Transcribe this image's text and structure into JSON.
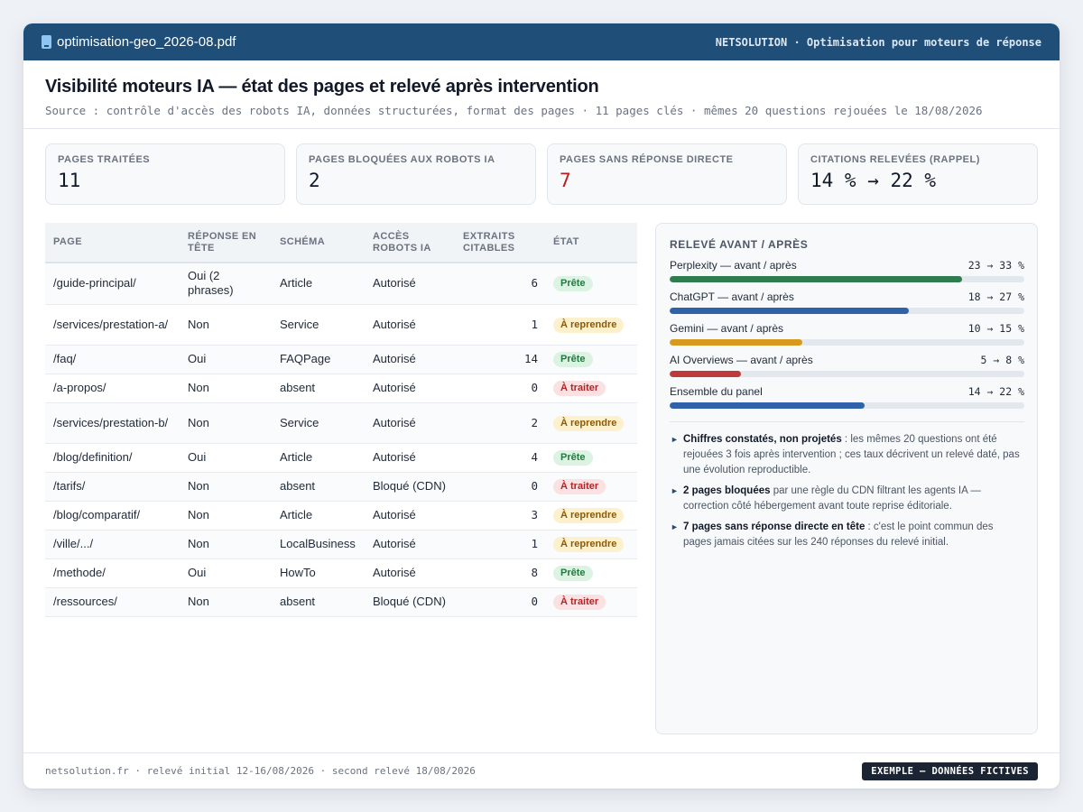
{
  "titlebar": {
    "filename": "optimisation-geo_2026-08.pdf",
    "brand": "NETSOLUTION · Optimisation pour moteurs de réponse"
  },
  "header": {
    "title": "Visibilité moteurs IA — état des pages et relevé après intervention",
    "source": "Source : contrôle d'accès des robots IA, données structurées, format des pages · 11 pages clés · mêmes 20 questions rejouées le 18/08/2026"
  },
  "kpis": [
    {
      "label": "PAGES TRAITÉES",
      "value": "11"
    },
    {
      "label": "PAGES BLOQUÉES AUX ROBOTS IA",
      "value": "2"
    },
    {
      "label": "PAGES SANS RÉPONSE DIRECTE",
      "value": "7"
    },
    {
      "label": "CITATIONS RELEVÉES (RAPPEL)",
      "value": "14 % → 22 %"
    }
  ],
  "table": {
    "headers": [
      "PAGE",
      "RÉPONSE EN TÊTE",
      "SCHÉMA",
      "ACCÈS ROBOTS IA",
      "EXTRAITS CITABLES",
      "ÉTAT"
    ],
    "rows": [
      {
        "page": "/guide-principal/",
        "reponse": "Oui (2 phrases)",
        "schema": "Article",
        "acces": "Autorisé",
        "extraits": "6",
        "etat": "Prête"
      },
      {
        "page": "/services/prestation-a/",
        "reponse": "Non",
        "schema": "Service",
        "acces": "Autorisé",
        "extraits": "1",
        "etat": "À reprendre"
      },
      {
        "page": "/faq/",
        "reponse": "Oui",
        "schema": "FAQPage",
        "acces": "Autorisé",
        "extraits": "14",
        "etat": "Prête"
      },
      {
        "page": "/a-propos/",
        "reponse": "Non",
        "schema": "absent",
        "acces": "Autorisé",
        "extraits": "0",
        "etat": "À traiter"
      },
      {
        "page": "/services/prestation-b/",
        "reponse": "Non",
        "schema": "Service",
        "acces": "Autorisé",
        "extraits": "2",
        "etat": "À reprendre"
      },
      {
        "page": "/blog/definition/",
        "reponse": "Oui",
        "schema": "Article",
        "acces": "Autorisé",
        "extraits": "4",
        "etat": "Prête"
      },
      {
        "page": "/tarifs/",
        "reponse": "Non",
        "schema": "absent",
        "acces": "Bloqué (CDN)",
        "extraits": "0",
        "etat": "À traiter"
      },
      {
        "page": "/blog/comparatif/",
        "reponse": "Non",
        "schema": "Article",
        "acces": "Autorisé",
        "extraits": "3",
        "etat": "À reprendre"
      },
      {
        "page": "/ville/.../",
        "reponse": "Non",
        "schema": "LocalBusiness",
        "acces": "Autorisé",
        "extraits": "1",
        "etat": "À reprendre"
      },
      {
        "page": "/methode/",
        "reponse": "Oui",
        "schema": "HowTo",
        "acces": "Autorisé",
        "extraits": "8",
        "etat": "Prête"
      },
      {
        "page": "/ressources/",
        "reponse": "Non",
        "schema": "absent",
        "acces": "Bloqué (CDN)",
        "extraits": "0",
        "etat": "À traiter"
      }
    ]
  },
  "status_colors": {
    "Prête": "green",
    "À reprendre": "amber",
    "À traiter": "red"
  },
  "panel": {
    "title": "RELEVÉ AVANT / APRÈS",
    "bars": [
      {
        "label": "Perplexity — avant / après",
        "value": "23 → 33 %",
        "before": 23,
        "after": 33,
        "color": "#2f7d4f"
      },
      {
        "label": "ChatGPT — avant / après",
        "value": "18 → 27 %",
        "before": 18,
        "after": 27,
        "color": "#2f62a8"
      },
      {
        "label": "Gemini — avant / après",
        "value": "10 → 15 %",
        "before": 10,
        "after": 15,
        "color": "#d89a1e"
      },
      {
        "label": "AI Overviews — avant / après",
        "value": "5 → 8 %",
        "before": 5,
        "after": 8,
        "color": "#bf3a3a"
      },
      {
        "label": "Ensemble du panel",
        "value": "14 → 22 %",
        "before": 14,
        "after": 22,
        "color": "#2f62a8"
      }
    ],
    "notes": [
      {
        "bold": "Chiffres constatés, non projetés",
        "text": " : les mêmes 20 questions ont été rejouées 3 fois après intervention ; ces taux décrivent un relevé daté, pas une évolution reproductible."
      },
      {
        "bold": "2 pages bloquées",
        "text": " par une règle du CDN filtrant les agents IA — correction côté hébergement avant toute reprise éditoriale."
      },
      {
        "bold": "7 pages sans réponse directe en tête",
        "text": " : c'est le point commun des pages jamais citées sur les 240 réponses du relevé initial."
      }
    ]
  },
  "footer": {
    "text": "netsolution.fr · relevé initial 12-16/08/2026 · second relevé 18/08/2026",
    "tag": "EXEMPLE — DONNÉES FICTIVES"
  }
}
